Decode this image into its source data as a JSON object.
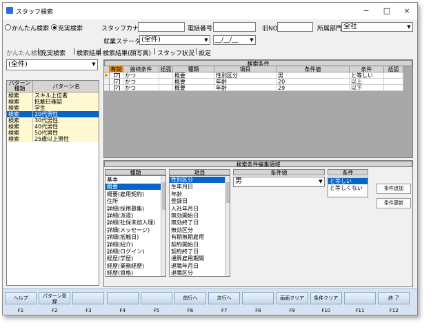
{
  "window": {
    "title": "スタッフ検索",
    "minimize": "−",
    "maximize": "□",
    "close": "×"
  },
  "search_mode": {
    "simple_label": "かんたん検索",
    "full_label": "充実検索",
    "selected": "full"
  },
  "fields": {
    "kana_label": "スタッフカナ",
    "kana_value": "",
    "phone_label": "電話番号",
    "phone_value": "",
    "oldno_label": "旧NO",
    "oldno_value": "",
    "dept_label": "所属部門",
    "dept_value": "全社",
    "status_label": "就業ステータス",
    "status_value": "(全件)",
    "date_value": "__/__/__"
  },
  "tabs": [
    "かんたん検索",
    "充実検索",
    "検索結果",
    "検索結果(顔写真)",
    "スタッフ状況",
    "設定"
  ],
  "tab_separator": "|",
  "active_tab": 1,
  "pattern_filter": "(全件)",
  "pattern_list": {
    "headers": [
      "パターン\n種類",
      "パターン名"
    ],
    "rows": [
      {
        "type": "検索",
        "name": "スキル上位者",
        "selected": false
      },
      {
        "type": "検索",
        "name": "抵触日確認",
        "selected": false
      },
      {
        "type": "検索",
        "name": "学生",
        "selected": false
      },
      {
        "type": "検索",
        "name": "20代男性",
        "selected": true
      },
      {
        "type": "検索",
        "name": "30代男性",
        "selected": false
      },
      {
        "type": "検索",
        "name": "40代男性",
        "selected": false
      },
      {
        "type": "検索",
        "name": "50代男性",
        "selected": false
      },
      {
        "type": "検索",
        "name": "25歳以上男性",
        "selected": false
      }
    ]
  },
  "conditions": {
    "title": "検索条件",
    "headers": [
      "有効",
      "接続条件",
      "括弧",
      "種類",
      "項目",
      "条件値",
      "条件",
      "括弧"
    ],
    "rows": [
      {
        "enabled": true,
        "connector": "かつ",
        "paren_open": "",
        "kind": "概要",
        "item": "性別区分",
        "value": "男",
        "cond": "と等しい",
        "paren_close": ""
      },
      {
        "enabled": true,
        "connector": "かつ",
        "paren_open": "",
        "kind": "概要",
        "item": "年齢",
        "value": "20",
        "cond": "以上",
        "paren_close": ""
      },
      {
        "enabled": true,
        "connector": "かつ",
        "paren_open": "",
        "kind": "概要",
        "item": "年齢",
        "value": "29",
        "cond": "以下",
        "paren_close": ""
      }
    ]
  },
  "editor": {
    "title": "検索条件編集領域",
    "kind_header": "種類",
    "item_header": "項目",
    "value_header": "条件値",
    "cond_header": "条件",
    "kinds": [
      "基本",
      "概要",
      "概要(雇用契約)",
      "住所",
      "詳細(採用募集)",
      "詳細(派遣)",
      "詳細(社保未加入理)",
      "詳細(メッセージ)",
      "詳細(抵触日)",
      "詳細(紹介)",
      "詳細(ログイン)",
      "経歴(学歴)",
      "経歴(業務経歴)",
      "経歴(資格)"
    ],
    "kind_selected": 1,
    "items": [
      "性別区分",
      "生年月日",
      "年齢",
      "登録日",
      "入社年月日",
      "無効開始日",
      "無効終了日",
      "無効区分",
      "有期無期雇用",
      "契約開始日",
      "契約終了日",
      "通算雇用期間",
      "退職年月日",
      "退職区分"
    ],
    "item_selected": 0,
    "value": "男",
    "conds": [
      "と等しい",
      "と等しくない"
    ],
    "cond_selected": 0,
    "add_button": "条件追加",
    "update_button": "条件更新"
  },
  "function_bar": [
    {
      "label": "ヘルプ",
      "key": "F1"
    },
    {
      "label": "パターン登\n録",
      "key": "F2"
    },
    {
      "label": "",
      "key": "F3"
    },
    {
      "label": "",
      "key": "F4"
    },
    {
      "label": "",
      "key": "F5"
    },
    {
      "label": "前行へ",
      "key": "F6"
    },
    {
      "label": "次行へ",
      "key": "F7"
    },
    {
      "label": "",
      "key": "F8"
    },
    {
      "label": "画面クリア",
      "key": "F9"
    },
    {
      "label": "条件クリア",
      "key": "F10"
    },
    {
      "label": "",
      "key": "F11"
    },
    {
      "label": "終 了",
      "key": "F12"
    }
  ],
  "colors": {
    "selection": "#0a64c8",
    "row_yellow": "#fff8d0",
    "function_bar": "#d6e4f2",
    "row_marker": "#e88a00"
  }
}
